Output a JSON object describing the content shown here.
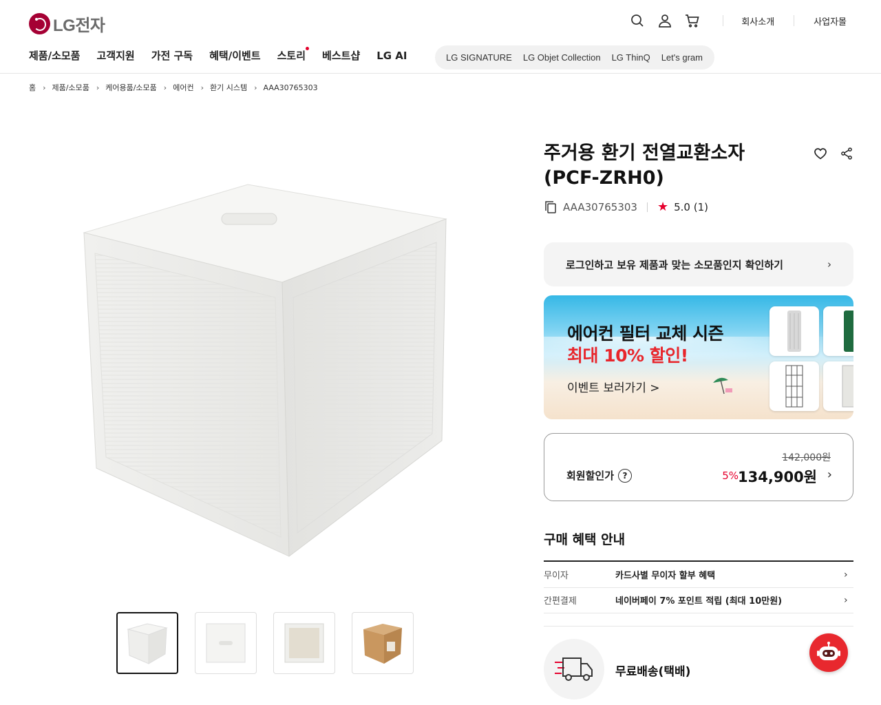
{
  "header": {
    "logo_text": "LG전자",
    "util_links": [
      "회사소개",
      "사업자몰"
    ],
    "menus": [
      "제품/소모품",
      "고객지원",
      "가전 구독",
      "혜택/이벤트",
      "스토리",
      "베스트샵",
      "LG AI"
    ],
    "brands": [
      "LG SIGNATURE",
      "LG Objet Collection",
      "LG ThinQ",
      "Let's gram"
    ]
  },
  "breadcrumb": [
    "홈",
    "제품/소모품",
    "케어용품/소모품",
    "에어컨",
    "환기 시스템",
    "AAA30765303"
  ],
  "product": {
    "title": "주거용 환기 전열교환소자 (PCF-ZRH0)",
    "model": "AAA30765303",
    "rating": "5.0 (1)"
  },
  "login_check": {
    "text": "로그인하고 보유 제품과 맞는 소모품인지 확인하기",
    "arrow": "›"
  },
  "banner": {
    "line1": "에어컨 필터 교체 시즌",
    "line2": "최대 10% 할인!",
    "more": "이벤트 보러가기 >"
  },
  "price": {
    "original": "142,000원",
    "label": "회원할인가",
    "discount": "5%",
    "final": "134,900원"
  },
  "benefits": {
    "title": "구매 혜택 안내",
    "rows": [
      {
        "key": "무이자",
        "value": "카드사별 무이자 할부 혜택"
      },
      {
        "key": "간편결제",
        "value": "네이버페이 7% 포인트 적립 (최대 10만원)"
      }
    ]
  },
  "shipping": {
    "text": "무료배송(택배)"
  },
  "colors": {
    "brand": "#a50034",
    "accent_red": "#e6002d",
    "chatbot": "#e8282e"
  }
}
